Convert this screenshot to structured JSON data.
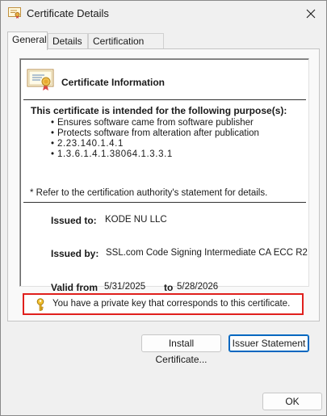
{
  "window": {
    "title": "Certificate Details",
    "icon": "certificate-icon",
    "close_icon": "close-icon"
  },
  "tabs": [
    {
      "label": "General",
      "active": true
    },
    {
      "label": "Details",
      "active": false
    },
    {
      "label": "Certification Path",
      "active": false
    }
  ],
  "general": {
    "info_title": "Certificate Information",
    "purpose_heading": "This certificate is intended for the following purpose(s):",
    "purposes": [
      "Ensures software came from software publisher",
      "Protects software from alteration after publication",
      "2.23.140.1.4.1",
      "1.3.6.1.4.1.38064.1.3.3.1"
    ],
    "refer_note": "* Refer to the certification authority's statement for details.",
    "issued_to_label": "Issued to:",
    "issued_to_value": "KODE NU LLC",
    "issued_by_label": "Issued by:",
    "issued_by_value": "SSL.com Code Signing Intermediate CA ECC R2",
    "valid_from_label": "Valid from",
    "valid_from_value": "5/31/2025",
    "valid_to_label": "to",
    "valid_to_value": "5/28/2026",
    "private_key_note": "You have a private key that corresponds to this certificate.",
    "highlight_color": "#e0201d"
  },
  "buttons": {
    "install": "Install Certificate...",
    "issuer": "Issuer Statement",
    "ok": "OK"
  }
}
